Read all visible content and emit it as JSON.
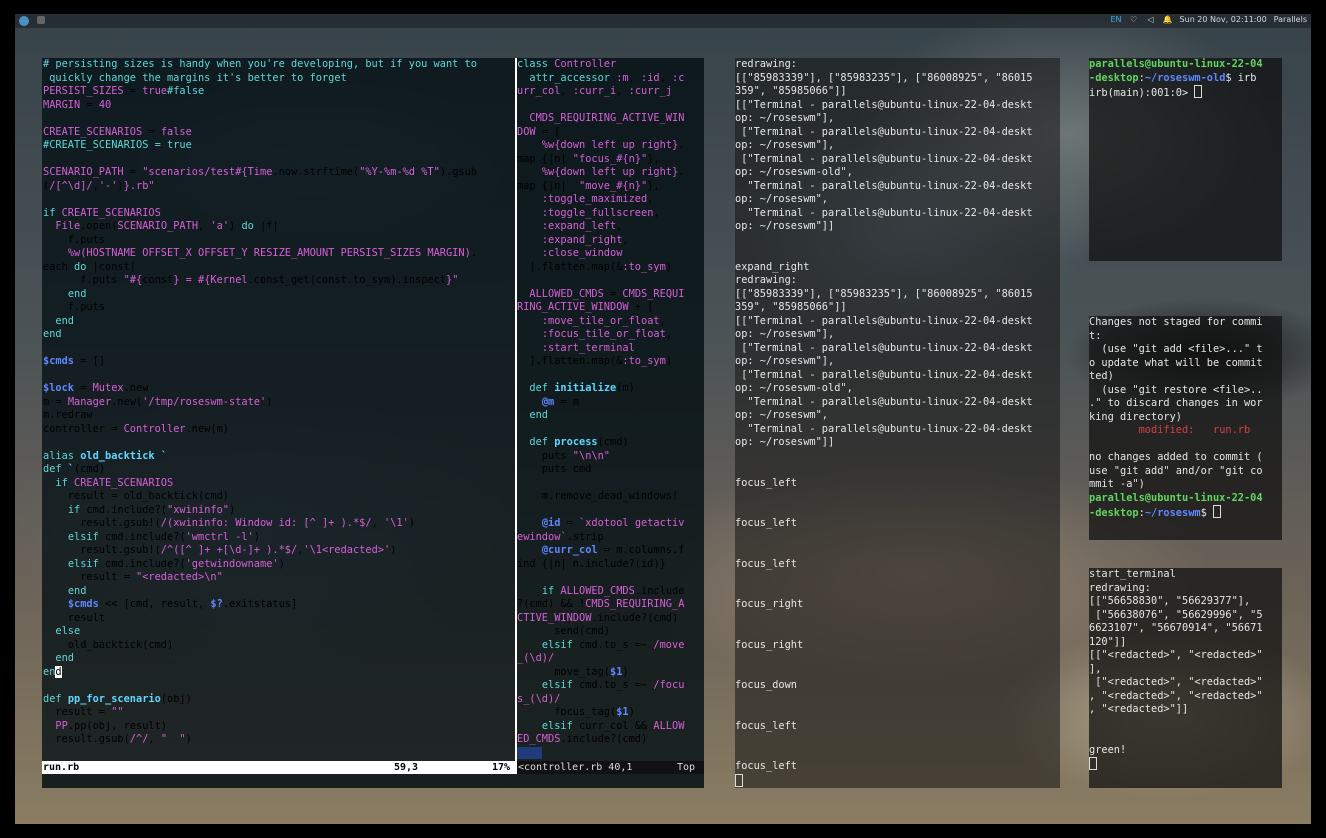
{
  "topbar": {
    "lang": "EN",
    "datetime": "Sun 20 Nov, 02:11:00",
    "user": "Parallels"
  },
  "vim": {
    "left_status": {
      "file": "run.rb",
      "position": "59,3",
      "percent": "17%"
    },
    "right_status": {
      "file": "<controller.rb 40,1",
      "scroll": "Top"
    }
  },
  "terminals": {
    "irb": {
      "prompt_user": "parallels@ubuntu-linux-22-04-desktop",
      "prompt_path": "~/roseswm-old",
      "command": "irb",
      "irb_prompt": "irb(main):001:0>"
    }
  }
}
